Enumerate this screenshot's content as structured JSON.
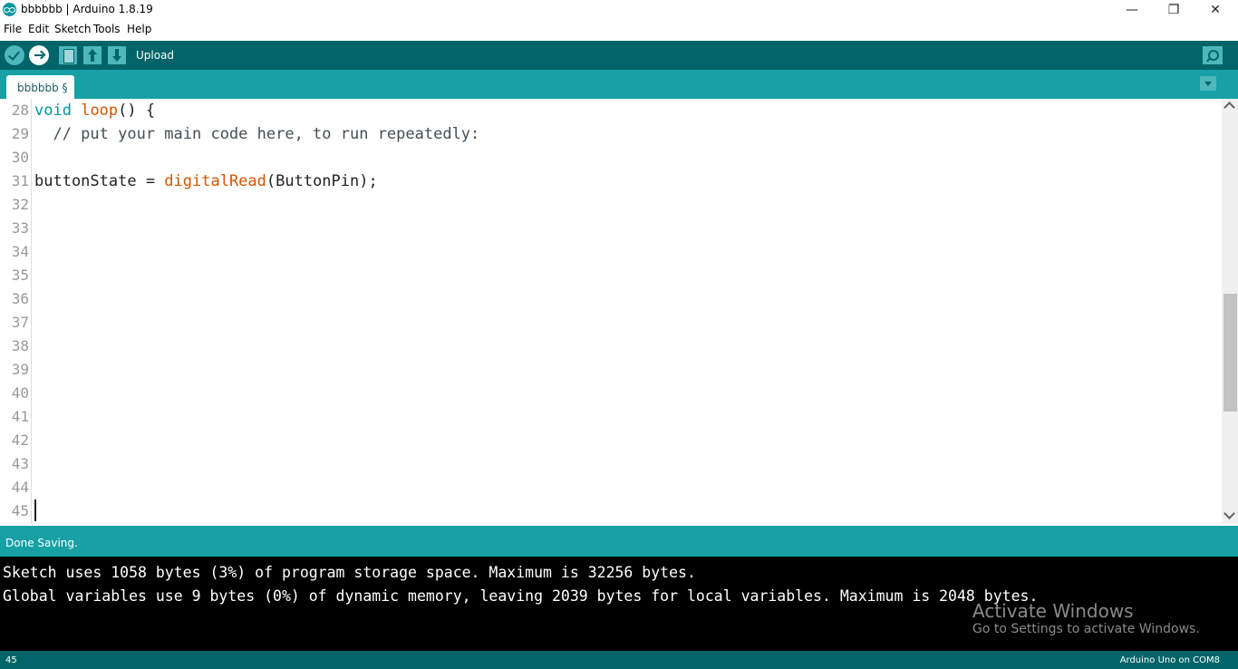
{
  "window": {
    "title": "bbbbbb | Arduino 1.8.19",
    "minimize": "—",
    "maximize": "❐",
    "close": "✕"
  },
  "menu": [
    "File",
    "Edit",
    "Sketch",
    "Tools",
    "Help"
  ],
  "toolbar": {
    "label": "Upload",
    "buttons": [
      "verify-icon",
      "upload-icon",
      "new-icon",
      "open-icon",
      "save-icon",
      "serial-monitor-icon"
    ]
  },
  "tabs": [
    {
      "label": "bbbbbb §"
    }
  ],
  "editor": {
    "lines": [
      {
        "n": "28",
        "code": [
          {
            "t": "void",
            "c": "kw"
          },
          {
            "t": " "
          },
          {
            "t": "loop",
            "c": "fn"
          },
          {
            "t": "() {"
          }
        ]
      },
      {
        "n": "29",
        "code": [
          {
            "t": "  // put your main code here, to run repeatedly:",
            "c": "cm"
          }
        ]
      },
      {
        "n": "30",
        "code": []
      },
      {
        "n": "31",
        "code": [
          {
            "t": "buttonState = "
          },
          {
            "t": "digitalRead",
            "c": "fn"
          },
          {
            "t": "(ButtonPin);"
          }
        ]
      },
      {
        "n": "32",
        "code": []
      },
      {
        "n": "33",
        "code": []
      },
      {
        "n": "34",
        "code": []
      },
      {
        "n": "35",
        "code": []
      },
      {
        "n": "36",
        "code": []
      },
      {
        "n": "37",
        "code": []
      },
      {
        "n": "38",
        "code": []
      },
      {
        "n": "39",
        "code": []
      },
      {
        "n": "40",
        "code": []
      },
      {
        "n": "41",
        "code": []
      },
      {
        "n": "42",
        "code": []
      },
      {
        "n": "43",
        "code": []
      },
      {
        "n": "44",
        "code": []
      },
      {
        "n": "45",
        "code": []
      }
    ]
  },
  "status": {
    "text": "Done Saving."
  },
  "console": {
    "lines": [
      "Sketch uses 1058 bytes (3%) of program storage space. Maximum is 32256 bytes.",
      "Global variables use 9 bytes (0%) of dynamic memory, leaving 2039 bytes for local variables. Maximum is 2048 bytes."
    ]
  },
  "watermark": {
    "title": "Activate Windows",
    "subtitle": "Go to Settings to activate Windows."
  },
  "bottom": {
    "line": "45",
    "board": "Arduino Uno on COM8"
  }
}
